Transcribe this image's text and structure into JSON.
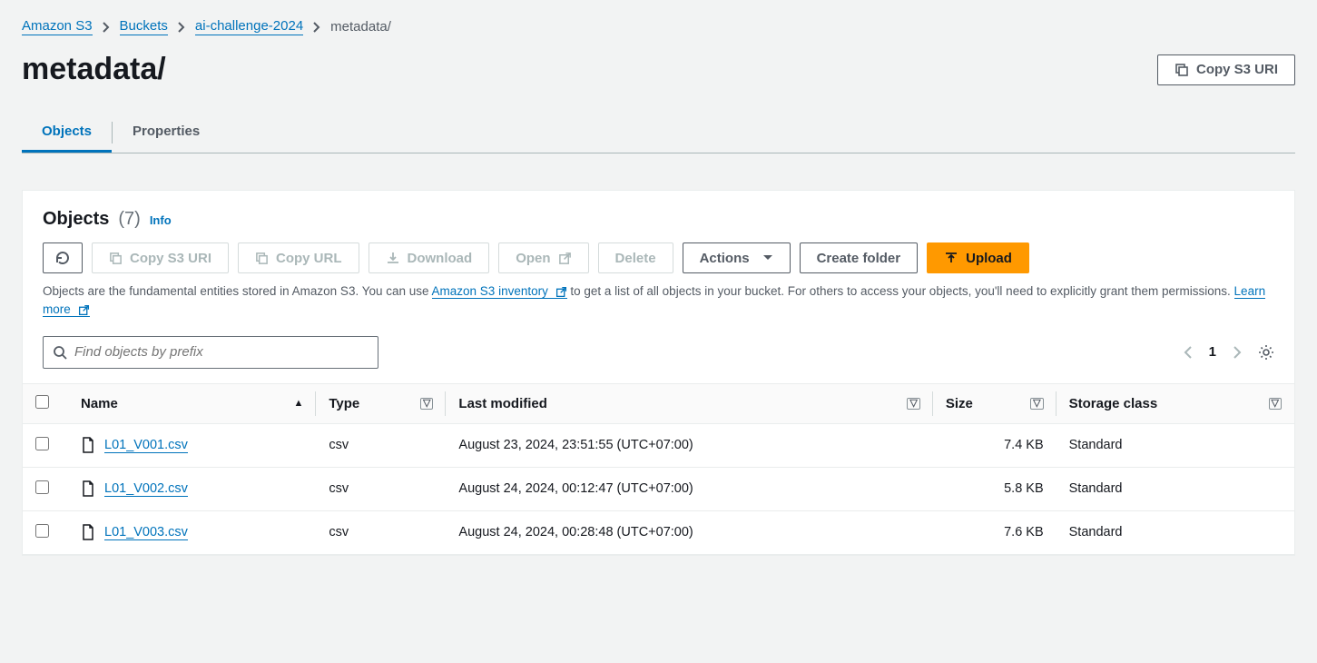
{
  "breadcrumb": {
    "root": "Amazon S3",
    "buckets": "Buckets",
    "bucket_name": "ai-challenge-2024",
    "current": "metadata/"
  },
  "page_title": "metadata/",
  "copy_uri_btn": "Copy S3 URI",
  "tabs": {
    "objects": "Objects",
    "properties": "Properties"
  },
  "section": {
    "title": "Objects",
    "count": "(7)",
    "info": "Info"
  },
  "toolbar": {
    "copy_uri": "Copy S3 URI",
    "copy_url": "Copy URL",
    "download": "Download",
    "open": "Open",
    "delete": "Delete",
    "actions": "Actions",
    "create_folder": "Create folder",
    "upload": "Upload"
  },
  "helptext": {
    "pre": "Objects are the fundamental entities stored in Amazon S3. You can use ",
    "inv_link": "Amazon S3 inventory",
    "mid": " to get a list of all objects in your bucket. For others to access your objects, you'll need to explicitly grant them permissions. ",
    "learn": "Learn more"
  },
  "search_placeholder": "Find objects by prefix",
  "page_number": "1",
  "columns": {
    "name": "Name",
    "type": "Type",
    "last_modified": "Last modified",
    "size": "Size",
    "storage_class": "Storage class"
  },
  "rows": [
    {
      "name": "L01_V001.csv",
      "type": "csv",
      "modified": "August 23, 2024, 23:51:55 (UTC+07:00)",
      "size": "7.4 KB",
      "storage": "Standard"
    },
    {
      "name": "L01_V002.csv",
      "type": "csv",
      "modified": "August 24, 2024, 00:12:47 (UTC+07:00)",
      "size": "5.8 KB",
      "storage": "Standard"
    },
    {
      "name": "L01_V003.csv",
      "type": "csv",
      "modified": "August 24, 2024, 00:28:48 (UTC+07:00)",
      "size": "7.6 KB",
      "storage": "Standard"
    }
  ]
}
